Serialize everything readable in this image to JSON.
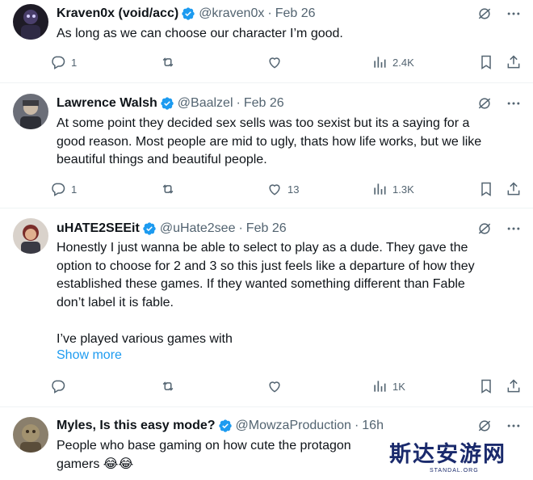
{
  "colors": {
    "accent": "#1d9bf0",
    "muted": "#536471",
    "text": "#0f1419",
    "divider": "#eff3f4"
  },
  "tweets": [
    {
      "name": "Kraven0x (void/acc)",
      "handle": "@kraven0x",
      "sep": "·",
      "date": "Feb 26",
      "text": "As long as we can choose our character I’m good.",
      "replies": "1",
      "retweets": "",
      "likes": "",
      "views": "2.4K"
    },
    {
      "name": "Lawrence Walsh",
      "handle": "@Baalzel",
      "sep": "·",
      "date": "Feb 26",
      "text": "At some point they decided sex sells was too sexist but its a saying for a\ngood reason.  Most people are mid to ugly, thats how life works, but we like\nbeautiful things and beautiful people.",
      "replies": "1",
      "retweets": "",
      "likes": "13",
      "views": "1.3K"
    },
    {
      "name": "uHATE2SEEit",
      "handle": "@uHate2see",
      "sep": "·",
      "date": "Feb 26",
      "text": "Honestly I just wanna be able to select to play as a dude. They gave the\noption to choose for 2 and 3 so this just feels like a departure of how they\nestablished these games. If they wanted something different than Fable\ndon’t label it is fable.\n\nI’ve played various games with",
      "show_more": "Show more",
      "replies": "",
      "retweets": "",
      "likes": "",
      "views": "1K"
    },
    {
      "name": "Myles, Is this easy mode?",
      "handle": "@MowzaProduction",
      "sep": "·",
      "date": "16h",
      "text": "People who base gaming on how cute the protagon\ngamers 😂😂"
    }
  ],
  "icons": {
    "grok": "grok-icon",
    "more": "more-icon",
    "reply": "reply-icon",
    "retweet": "retweet-icon",
    "like": "like-icon",
    "views": "views-icon",
    "bookmark": "bookmark-icon",
    "share": "share-icon",
    "verified": "verified-badge-icon"
  },
  "watermark": {
    "text": "斯达安游网",
    "sub": "STANDAL.ORG"
  }
}
